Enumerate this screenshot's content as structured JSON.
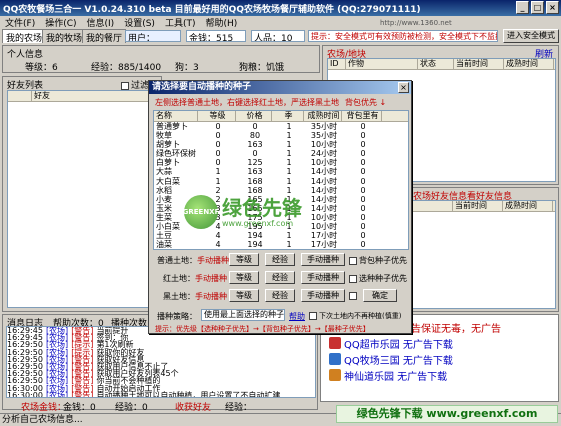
{
  "window": {
    "title": "QQ农牧餐场三合一  V1.0.24.310 beta 目前最好用的QQ农场牧场餐厅辅助软件  (QQ:279071111)",
    "min": "_",
    "max": "□",
    "close": "×"
  },
  "menu": [
    "文件(F)",
    "操作(C)",
    "信息(I)",
    "设置(S)",
    "工具(T)",
    "帮助(H)"
  ],
  "site": "http://www.1360.net",
  "tabs": [
    "我的农场",
    "我的牧场",
    "我的餐厅"
  ],
  "top_fields": {
    "user_label": "用户：",
    "gold_label": "金钱：515",
    "people_label": "人品：10"
  },
  "hint": "提示：安全模式可有效预防被检测，安全模式下不监控好友",
  "safe_mode_btn": "进入安全模式",
  "personal": {
    "title": "个人信息",
    "level": "等级：6",
    "exp": "经验：885/1400",
    "dog": "狗：3",
    "dog_state": "狗粮：饥饿"
  },
  "friend_list": {
    "title": "好友列表",
    "filter": "过滤",
    "col_friend": "好友"
  },
  "farm_land": {
    "title": "农场/地块",
    "refresh": "刷新",
    "cols": [
      "ID",
      "作物",
      "状态",
      "当前时间",
      "成熟时间"
    ]
  },
  "friend_info": {
    "title": "农场好友信息看好友信息",
    "cols": [
      "当前时间",
      "成熟时间"
    ]
  },
  "dialog": {
    "title": "请选择要自动播种的种子",
    "tip": "左侧选择普通土地，右键选择红土地，严选择黑土地",
    "tip2": "背包优先 ↓",
    "cols": [
      "名称",
      "等级",
      "价格",
      "季",
      "成熟时间",
      "背包里有"
    ],
    "seeds": [
      [
        "普通萝卜",
        "0",
        "0",
        "1",
        "35小时",
        "0"
      ],
      [
        "牧草",
        "0",
        "80",
        "1",
        "35小时",
        "0"
      ],
      [
        "胡萝卜",
        "0",
        "163",
        "1",
        "10小时",
        "0"
      ],
      [
        "绿色环保树",
        "0",
        "0",
        "1",
        "24小时",
        "0"
      ],
      [
        "白萝卜",
        "0",
        "125",
        "1",
        "10小时",
        "0"
      ],
      [
        "大蒜",
        "1",
        "163",
        "1",
        "14小时",
        "0"
      ],
      [
        "大白菜",
        "1",
        "168",
        "1",
        "14小时",
        "0"
      ],
      [
        "水稻",
        "2",
        "168",
        "1",
        "14小时",
        "0"
      ],
      [
        "小麦",
        "2",
        "165",
        "1",
        "14小时",
        "0"
      ],
      [
        "玉米",
        "3",
        "165",
        "1",
        "14小时",
        "0"
      ],
      [
        "生菜",
        "3",
        "175",
        "1",
        "10小时",
        "0"
      ],
      [
        "小白菜",
        "4",
        "195",
        "1",
        "10小时",
        "0"
      ],
      [
        "土豆",
        "4",
        "194",
        "1",
        "17小时",
        "0"
      ],
      [
        "油菜",
        "4",
        "194",
        "1",
        "17小时",
        "0"
      ],
      [
        "红色曼陀罗树",
        "5",
        "237",
        "1",
        "16小时",
        "0"
      ],
      [
        "黄色曼陀罗树",
        "5",
        "237",
        "1",
        "16小时",
        "0"
      ]
    ],
    "normal_land": "普通土地：",
    "red_land": "红土地：",
    "black_land": "黑土地：",
    "manual": "手动播种",
    "level": "等级",
    "exp": "经验",
    "manual_btn": "手动播种",
    "bag_seed_first": "背包种子优先",
    "plant_seed_first": "选种种子优先",
    "fruit_first": "果实种子优先",
    "confirm": "确定",
    "strategy_label": "播种策略：",
    "strategy_value": "使用最上面选择的种子",
    "help": "帮助",
    "no_seed": "下次土地内不再种植(慎重)",
    "bottom_tip": "提示：优先级【选种种子优先】→【背包种子优先】→【最种子优先】"
  },
  "logs": {
    "tab1": "消息日志",
    "tab2": "帮助次数：0",
    "tab3": "播种次数",
    "entries": [
      [
        "16:29:45",
        "[农场]",
        "[警告]",
        "当前提升"
      ],
      [
        "16:29:45",
        "[农场]",
        "[警告]",
        "签到：你"
      ],
      [
        "16:29:50",
        "[农场]",
        "[提示]",
        "第1次刷新"
      ],
      [
        "16:29:50",
        "[农场]",
        "[提示]",
        "获取你的好友"
      ],
      [
        "16:29:50",
        "[农场]",
        "[警告]",
        "获取好友信息"
      ],
      [
        "16:29:50",
        "[农场]",
        "[警告]",
        "获取用户信息不止了"
      ],
      [
        "16:29:50",
        "[农场]",
        "[警告]",
        "获取用户好友列表45个"
      ],
      [
        "16:29:50",
        "[农场]",
        "[警告]",
        "你当前不会种植的"
      ],
      [
        "16:30:00",
        "[农场]",
        "[警告]",
        "自动开始启动工作"
      ],
      [
        "16:30:00",
        "[农场]",
        "[警告]",
        "自动播种土地可以自动种植，用户设置了不自动扩建"
      ]
    ]
  },
  "ads": {
    "top": "告保证无毒，无广告",
    "items": [
      "QQ超市乐园  无广告下载",
      "QQ牧场三国  无广告下载",
      "神仙道乐园  无广告下载"
    ]
  },
  "bottom_bar": {
    "farm_gold": "农场金钱：",
    "gold": "金钱：0",
    "exp": "经验：0",
    "friends": "收获好友",
    "exp2": "经验："
  },
  "status_text": "分析自己农场信息...",
  "watermark": "绿色先锋下载  www.greenxf.com",
  "logo_text": "绿色先锋",
  "logo_url": "www.greenxf.com",
  "logo_brand": "GREENXF"
}
